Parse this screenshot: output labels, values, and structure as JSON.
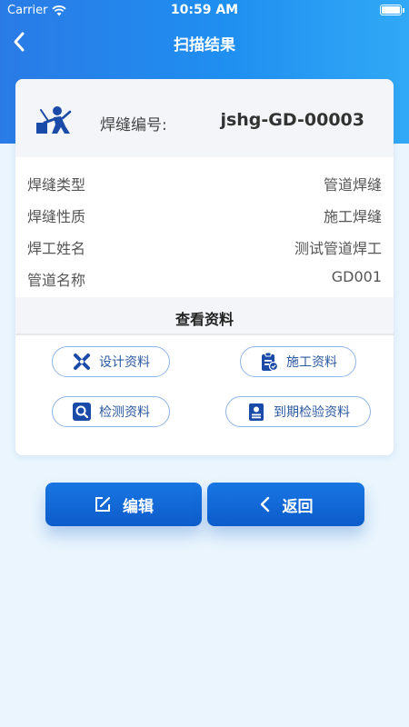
{
  "status_bar": {
    "carrier": "Carrier",
    "time": "10:59 AM"
  },
  "nav": {
    "title": "扫描结果"
  },
  "weld": {
    "label": "焊缝编号:",
    "code": "jshg-GD-00003"
  },
  "info": [
    {
      "key": "焊缝类型",
      "value": "管道焊缝"
    },
    {
      "key": "焊缝性质",
      "value": "施工焊缝"
    },
    {
      "key": "焊工姓名",
      "value": "测试管道焊工"
    },
    {
      "key": "管道名称",
      "value": "GD001"
    }
  ],
  "docs": {
    "section_title": "查看资料",
    "design": "设计资料",
    "construction": "施工资料",
    "inspection": "检测资料",
    "expiry": "到期检验资料"
  },
  "actions": {
    "edit": "编辑",
    "back": "返回"
  },
  "colors": {
    "primary": "#1f8ff0",
    "button": "#0d5ccb",
    "icon": "#1a4ba8"
  },
  "icons": {
    "status": [
      "wifi-icon",
      "battery-icon"
    ],
    "nav": "back-chevron-icon",
    "weld": "welder-icon",
    "docs": [
      "design-tools-icon",
      "clipboard-icon",
      "magnifier-icon",
      "badge-document-icon"
    ],
    "actions": [
      "edit-icon",
      "chevron-left-icon"
    ]
  }
}
